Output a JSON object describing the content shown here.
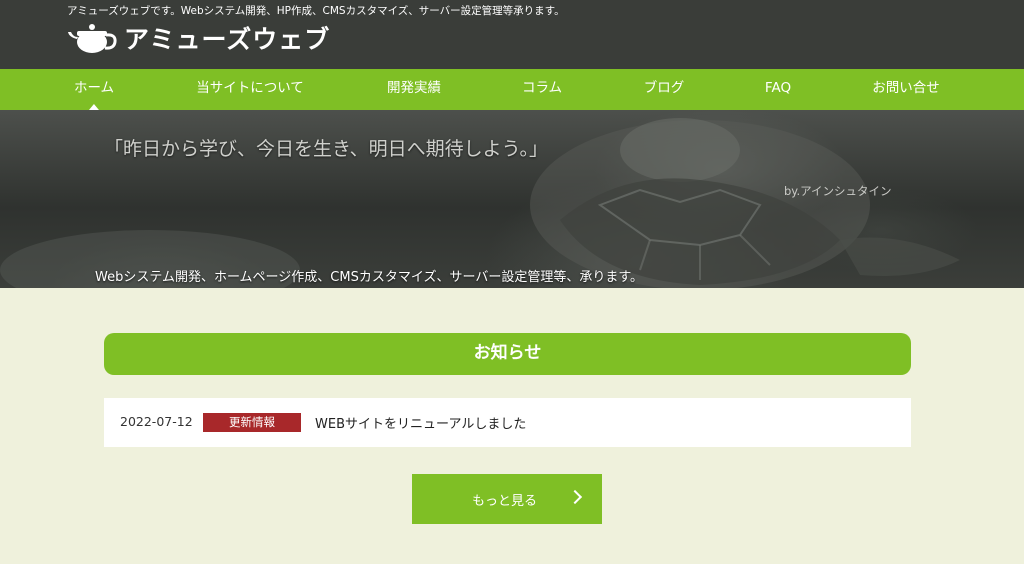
{
  "header": {
    "tagline": "アミューズウェブです。Webシステム開発、HP作成、CMSカスタマイズ、サーバー設定管理等承ります。",
    "logo_text": "アミューズウェブ"
  },
  "nav": {
    "items": [
      {
        "label": "ホーム",
        "active": true
      },
      {
        "label": "当サイトについて"
      },
      {
        "label": "開発実績"
      },
      {
        "label": "コラム"
      },
      {
        "label": "ブログ"
      },
      {
        "label": "FAQ"
      },
      {
        "label": "お問い合せ"
      }
    ]
  },
  "hero": {
    "quote": "「昨日から学び、今日を生き、明日へ期待しよう。」",
    "author": "by.アインシュタイン",
    "caption": "Webシステム開発、ホームページ作成、CMSカスタマイズ、サーバー設定管理等、承ります。"
  },
  "news": {
    "heading": "お知らせ",
    "items": [
      {
        "date": "2022-07-12",
        "badge": "更新情報",
        "title": "WEBサイトをリニューアルしました"
      }
    ],
    "more_label": "もっと見る"
  },
  "colors": {
    "header_bg": "#3a3d39",
    "brand_green": "#7fbf25",
    "badge_red": "#a8282a",
    "page_bg": "#eff1dc"
  }
}
